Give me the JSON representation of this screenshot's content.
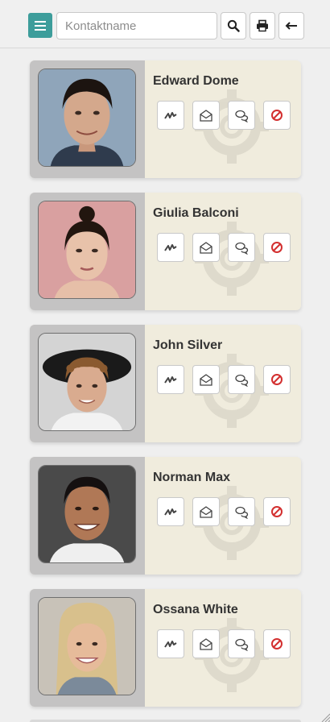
{
  "toolbar": {
    "menu_icon": "hamburger-icon",
    "search": {
      "placeholder": "Kontaktname",
      "value": ""
    },
    "search_icon": "search-icon",
    "print_icon": "printer-icon",
    "back_icon": "arrow-left-icon"
  },
  "colors": {
    "accent": "#3d9d9b",
    "card_bg": "#f0ecdd",
    "card_left_bg": "#c4c3c3",
    "block_icon": "#d32f2f"
  },
  "contacts": [
    {
      "name": "Edward Dome"
    },
    {
      "name": "Giulia Balconi"
    },
    {
      "name": "John Silver"
    },
    {
      "name": "Norman Max"
    },
    {
      "name": "Ossana White"
    }
  ],
  "card_actions": [
    "activity-icon",
    "envelope-open-icon",
    "chat-bubbles-icon",
    "block-icon"
  ]
}
